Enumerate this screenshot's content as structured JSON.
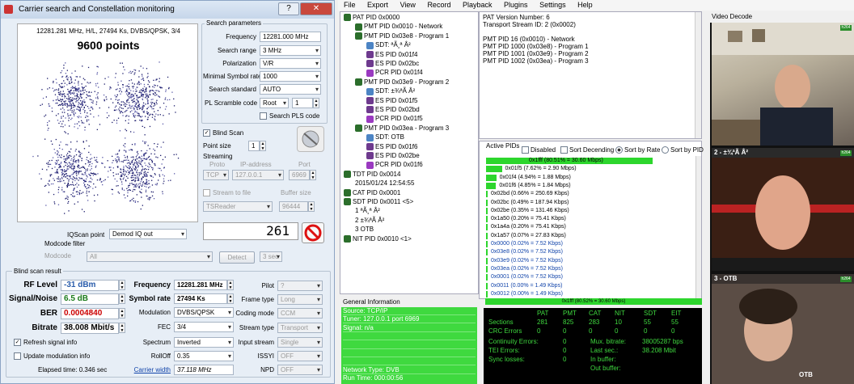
{
  "dialog": {
    "title": "Carrier search and Constellation monitoring",
    "help_btn": "?",
    "close_btn": "✕",
    "scatter": {
      "freq_info": "12281.281 MHz, H/L, 27494 Ks, DVBS/QPSK, 3/4",
      "points": "9600 points"
    },
    "search": {
      "header": "Search parameters",
      "frequency_label": "Frequency",
      "frequency": "12281.000 MHz",
      "range_label": "Search range",
      "range": "3 MHz",
      "polarization_label": "Polarization",
      "polarization": "V/R",
      "min_sr_label": "Minimal Symbol rate",
      "min_sr": "1000",
      "standard_label": "Search standard",
      "standard": "AUTO",
      "pl_label": "PL Scramble code",
      "pl_mode": "Root",
      "pl_value": "1",
      "search_pls": "Search PLS code"
    },
    "blind_scan": "Blind Scan",
    "point_size_label": "Point size",
    "point_size": "1",
    "streaming": {
      "header": "Streaming",
      "proto_h": "Proto",
      "ip_h": "IP-address",
      "port_h": "Port",
      "proto": "TCP",
      "ip": "127.0.0.1",
      "port": "6969",
      "to_file": "Stream to file",
      "buffer_h": "Buffer size",
      "reader": "TSReader",
      "buffer": "96444"
    },
    "iq_label": "IQScan point",
    "iq_value": "Demod IQ out",
    "counter": "261",
    "modcode": {
      "header": "Modcode filter",
      "label": "Modcode",
      "value": "All",
      "detect": "Detect",
      "sec": "3 sec"
    },
    "result": {
      "header": "Blind scan result",
      "rf_label": "RF Level",
      "rf": "-31 dBm",
      "sn_label": "Signal/Noise",
      "sn": "6.5 dB",
      "ber_label": "BER",
      "ber": "0.0004840",
      "bitrate_label": "Bitrate",
      "bitrate": "38.008 Mbit/s",
      "freq_label": "Frequency",
      "freq": "12281.281 MHz",
      "sr_label": "Symbol rate",
      "sr": "27494 Ks",
      "mod_label": "Modulation",
      "mod": "DVBS/QPSK",
      "fec_label": "FEC",
      "fec": "3/4",
      "spectrum_label": "Spectrum",
      "spectrum": "Inverted",
      "rolloff_label": "RollOff",
      "rolloff": "0.35",
      "carrier_label": "Carrier width",
      "carrier": "37.118 MHz",
      "pilot_label": "Pilot",
      "pilot": "?",
      "frame_label": "Frame type",
      "frame": "Long",
      "coding_label": "Coding mode",
      "coding": "CCM",
      "stream_label": "Stream type",
      "stream": "Transport",
      "input_label": "Input stream",
      "input": "Single",
      "issyi_label": "ISSYI",
      "issyi": "OFF",
      "npd_label": "NPD",
      "npd": "OFF",
      "refresh": "Refresh signal info",
      "update": "Update modulation info",
      "elapsed": "Elapsed time: 0.346 sec"
    }
  },
  "menu": [
    "File",
    "Export",
    "View",
    "Record",
    "Playback",
    "Plugins",
    "Settings",
    "Help"
  ],
  "tree": [
    "PAT PID 0x0000",
    "PMT PID 0x0010 - Network",
    "PMT PID 0x03e8 - Program 1",
    "SDT: ªÃ¸ª Â²",
    "ES PID 0x01f4",
    "ES PID 0x02bc",
    "PCR PID 0x01f4",
    "PMT PID 0x03e9 - Program 2",
    "SDT: ±¾ªÃ Â²",
    "ES PID 0x01f5",
    "ES PID 0x02bd",
    "PCR PID 0x01f5",
    "PMT PID 0x03ea - Program 3",
    "SDT: OTB",
    "ES PID 0x01f6",
    "ES PID 0x02be",
    "PCR PID 0x01f6",
    "TDT PID 0x0014",
    "2015/01/24 12:54:55",
    "CAT PID 0x0001",
    "SDT PID 0x0011 <5>",
    "1 ªÃ¸ª Â²",
    "2 ±¾ªÃ Â²",
    "3 OTB",
    "NIT PID 0x0010 <1>"
  ],
  "pat_info": [
    "PAT Version Number: 6",
    "Transport Stream ID: 2 (0x0002)",
    "",
    "PMT PID 16 (0x0010) - Network",
    "PMT PID 1000 (0x03e8) - Program 1",
    "PMT PID 1001 (0x03e9) - Program 2",
    "PMT PID 1002 (0x03ea) - Program 3"
  ],
  "pids": {
    "title": "Active PIDs",
    "disabled": "Disabled",
    "sort_desc": "Sort Decending",
    "sort_rate": "Sort by Rate",
    "sort_pid": "Sort by PID",
    "rows": [
      {
        "text": "0x1fff (80.51% = 30.60 Mbps)",
        "pct": 0.8051
      },
      {
        "text": "0x01f5 (7.62% = 2.90 Mbps)",
        "pct": 0.0762
      },
      {
        "text": "0x01f4 (4.94% = 1.88 Mbps)",
        "pct": 0.0494
      },
      {
        "text": "0x01f6 (4.85% = 1.84 Mbps)",
        "pct": 0.0485
      },
      {
        "text": "0x02bd (0.66% = 250.69 Kbps)",
        "pct": 0.0066
      },
      {
        "text": "0x02bc (0.49% = 187.94 Kbps)",
        "pct": 0.0049
      },
      {
        "text": "0x02be (0.35% = 131.46 Kbps)",
        "pct": 0.0035
      },
      {
        "text": "0x1a50 (0.20% = 75.41 Kbps)",
        "pct": 0.002
      },
      {
        "text": "0x1a4a (0.20% = 75.41 Kbps)",
        "pct": 0.002
      },
      {
        "text": "0x1a57 (0.07% = 27.83 Kbps)",
        "pct": 0.0007
      },
      {
        "text": "0x0000 (0.02% = 7.52 Kbps)",
        "pct": 0.0002
      },
      {
        "text": "0x03e8 (0.02% = 7.52 Kbps)",
        "pct": 0.0002
      },
      {
        "text": "0x03e9 (0.02% = 7.52 Kbps)",
        "pct": 0.0002
      },
      {
        "text": "0x03ea (0.02% = 7.52 Kbps)",
        "pct": 0.0002
      },
      {
        "text": "0x0001 (0.02% = 7.52 Kbps)",
        "pct": 0.0002
      },
      {
        "text": "0x0011 (0.00% = 1.49 Kbps)",
        "pct": 0.0
      },
      {
        "text": "0x0012 (0.00% = 1.49 Kbps)",
        "pct": 0.0
      }
    ],
    "footer": "0x1fff (80.52% = 30.60 Mbps)"
  },
  "general": {
    "title": "General Information",
    "lines": [
      "Source: TCP/IP",
      "Tuner: 127.0.0.1 port 6969",
      "Signal: n/a",
      "",
      "",
      "",
      "",
      "Network Type: DVB",
      "Run Time: 000:00:56"
    ]
  },
  "stats": {
    "headers": [
      "PAT",
      "PMT",
      "CAT",
      "NIT",
      "SDT",
      "EIT"
    ],
    "sections_label": "Sections",
    "sections": [
      "281",
      "825",
      "283",
      "10",
      "55",
      "55"
    ],
    "crc_label": "CRC Errors",
    "crc": [
      "0",
      "0",
      "0",
      "0",
      "0",
      "0"
    ],
    "cont_label": "Continuity Errors:",
    "cont": "0",
    "tei_label": "TEI Errors:",
    "tei": "0",
    "sync_label": "Sync losses:",
    "sync": "0",
    "mux_label": "Mux. bitrate:",
    "mux": "38005287 bps",
    "last_label": "Last sec.:",
    "last": "38.208 Mbit",
    "inbuf_label": "In buffer:",
    "outbuf_label": "Out buffer:"
  },
  "video": {
    "title": "Video Decode",
    "ch2": "2 - ±¾ªÃ Â²",
    "ch3": "3 - OTB",
    "otb": "OTB",
    "badge": "h264"
  }
}
